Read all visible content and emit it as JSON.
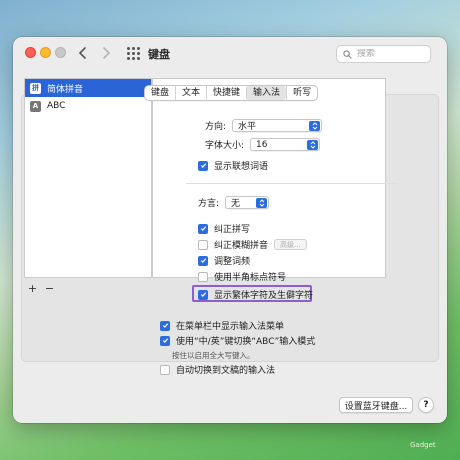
{
  "window": {
    "title": "键盘"
  },
  "search": {
    "placeholder": "搜索"
  },
  "tabs": [
    {
      "label": "键盘"
    },
    {
      "label": "文本"
    },
    {
      "label": "快捷键"
    },
    {
      "label": "输入法",
      "active": true
    },
    {
      "label": "听写"
    }
  ],
  "sources": [
    {
      "label": "简体拼音",
      "icon": "拼",
      "selected": true
    },
    {
      "label": "ABC",
      "icon": "A",
      "selected": false
    }
  ],
  "settings": {
    "direction_label": "方向:",
    "direction_value": "水平",
    "font_size_label": "字体大小:",
    "font_size_value": "16",
    "show_predictive": "显示联想词语",
    "dialect_label": "方言:",
    "dialect_value": "无",
    "autocorrect": "纠正拼写",
    "fuzzy_pinyin": "纠正模糊拼音",
    "advanced_button": "高级...",
    "adjust_frequency": "调整词频",
    "half_width_punct": "使用半角标点符号",
    "show_traditional": "显示繁体字符及生僻字符"
  },
  "bottom": {
    "show_menu": "在菜单栏中显示输入法菜单",
    "use_shift": "使用“中/英”键切换“ABC”输入模式",
    "shift_hint": "按住以启用全大写键入。",
    "auto_switch": "自动切换到文稿的输入法",
    "bluetooth_button": "设置蓝牙键盘...",
    "help_button": "?"
  },
  "states": {
    "show_predictive": true,
    "autocorrect": true,
    "fuzzy_pinyin": false,
    "adjust_frequency": true,
    "half_width_punct": false,
    "show_traditional": true,
    "show_menu": true,
    "use_shift": true,
    "auto_switch": false
  },
  "watermark": "Gadget"
}
